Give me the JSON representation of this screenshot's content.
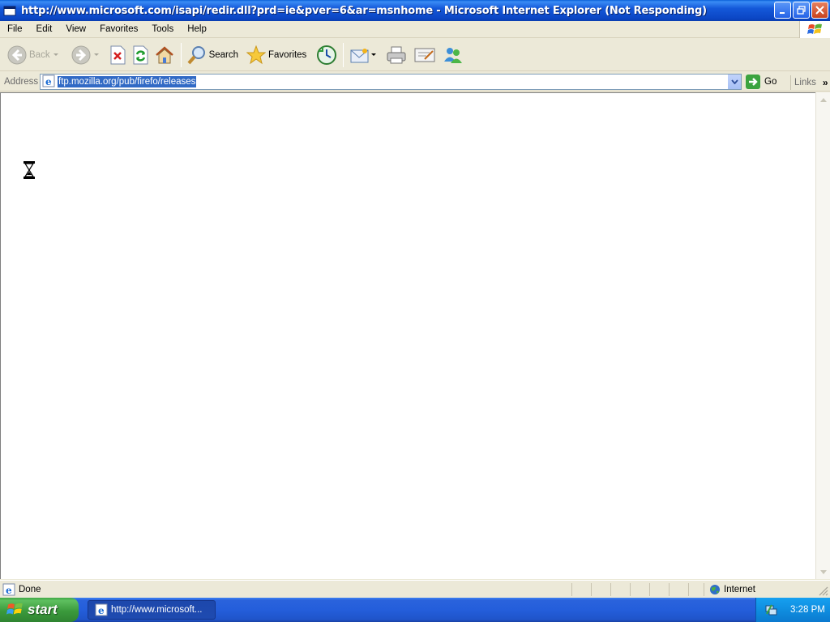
{
  "window": {
    "title": "http://www.microsoft.com/isapi/redir.dll?prd=ie&pver=6&ar=msnhome - Microsoft Internet Explorer (Not Responding)"
  },
  "menubar": {
    "items": [
      "File",
      "Edit",
      "View",
      "Favorites",
      "Tools",
      "Help"
    ]
  },
  "toolbar": {
    "back_label": "Back",
    "search_label": "Search",
    "favorites_label": "Favorites"
  },
  "addressbar": {
    "label": "Address",
    "value": "ftp.mozilla.org/pub/firefo/releases",
    "go_label": "Go",
    "links_label": "Links"
  },
  "statusbar": {
    "status": "Done",
    "zone": "Internet"
  },
  "taskbar": {
    "start_label": "start",
    "task_label": "http://www.microsoft...",
    "clock": "3:28 PM"
  },
  "colors": {
    "titlebar": "#0b46c4",
    "selection": "#316ac5",
    "taskbar": "#245edb",
    "start": "#3b9a3c",
    "tray": "#0f8ee0"
  }
}
